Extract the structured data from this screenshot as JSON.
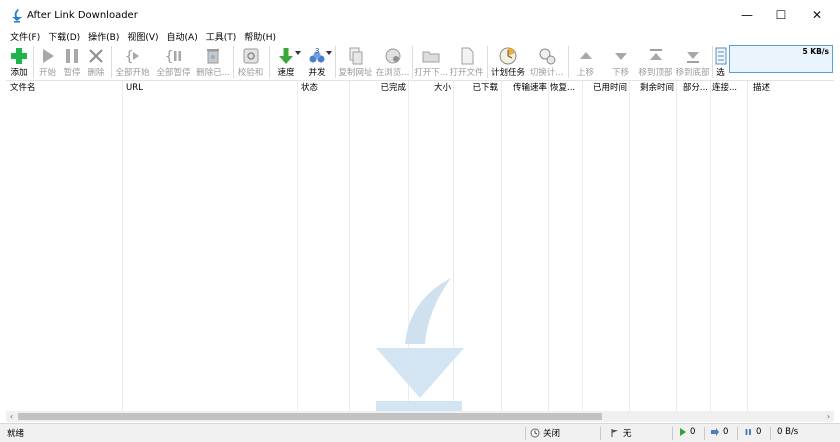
{
  "window": {
    "title": "After Link Downloader",
    "minimize_glyph": "—",
    "maximize_glyph": "☐",
    "close_glyph": "✕"
  },
  "menu": [
    "文件(F)",
    "下载(D)",
    "操作(B)",
    "视图(V)",
    "自动(A)",
    "工具(T)",
    "帮助(H)"
  ],
  "toolbar": {
    "buttons": [
      {
        "label": "添加",
        "icon": "add-icon",
        "enabled": true
      },
      {
        "label": "开始",
        "icon": "play-icon",
        "enabled": false
      },
      {
        "label": "暂停",
        "icon": "pause-icon",
        "enabled": false
      },
      {
        "label": "删除",
        "icon": "delete-icon",
        "enabled": false
      },
      {
        "label": "全部开始",
        "icon": "start-all-icon",
        "enabled": false
      },
      {
        "label": "全部暂停",
        "icon": "pause-all-icon",
        "enabled": false
      },
      {
        "label": "删除已...",
        "icon": "delete-completed-icon",
        "enabled": false
      },
      {
        "label": "校验和",
        "icon": "checksum-icon",
        "enabled": false
      },
      {
        "label": "速度",
        "icon": "speed-icon",
        "enabled": true
      },
      {
        "label": "并发",
        "icon": "concurrency-icon",
        "enabled": true
      },
      {
        "label": "复制网址",
        "icon": "copy-url-icon",
        "enabled": false
      },
      {
        "label": "在浏览...",
        "icon": "open-in-browser-icon",
        "enabled": false
      },
      {
        "label": "打开下...",
        "icon": "open-folder-icon",
        "enabled": false
      },
      {
        "label": "打开文件",
        "icon": "open-file-icon",
        "enabled": false
      },
      {
        "label": "计划任务",
        "icon": "schedule-icon",
        "enabled": true
      },
      {
        "label": "切换计...",
        "icon": "toggle-schedule-icon",
        "enabled": false
      },
      {
        "label": "上移",
        "icon": "move-up-icon",
        "enabled": false
      },
      {
        "label": "下移",
        "icon": "move-down-icon",
        "enabled": false
      },
      {
        "label": "移到顶部",
        "icon": "move-top-icon",
        "enabled": false
      },
      {
        "label": "移到底部",
        "icon": "move-bottom-icon",
        "enabled": false
      },
      {
        "label": "选",
        "icon": "options-icon",
        "enabled": true
      }
    ],
    "speed_graph": "5 KB/s"
  },
  "columns": [
    "文件名",
    "URL",
    "状态",
    "已完成",
    "大小",
    "已下载",
    "传输速率",
    "恢复...",
    "已用时间",
    "剩余时间",
    "部分...",
    "连接...",
    "描述"
  ],
  "scroll": {
    "left": "‹",
    "right": "›"
  },
  "statusbar": {
    "ready": "就绪",
    "schedule": "关闭",
    "limit": "无",
    "active": "0",
    "queued": "0",
    "paused": "0",
    "rate": "0 B/s"
  },
  "colors": {
    "accent": "#5a9fd4",
    "add_green": "#1fb54a",
    "download_green": "#3aa83a"
  }
}
